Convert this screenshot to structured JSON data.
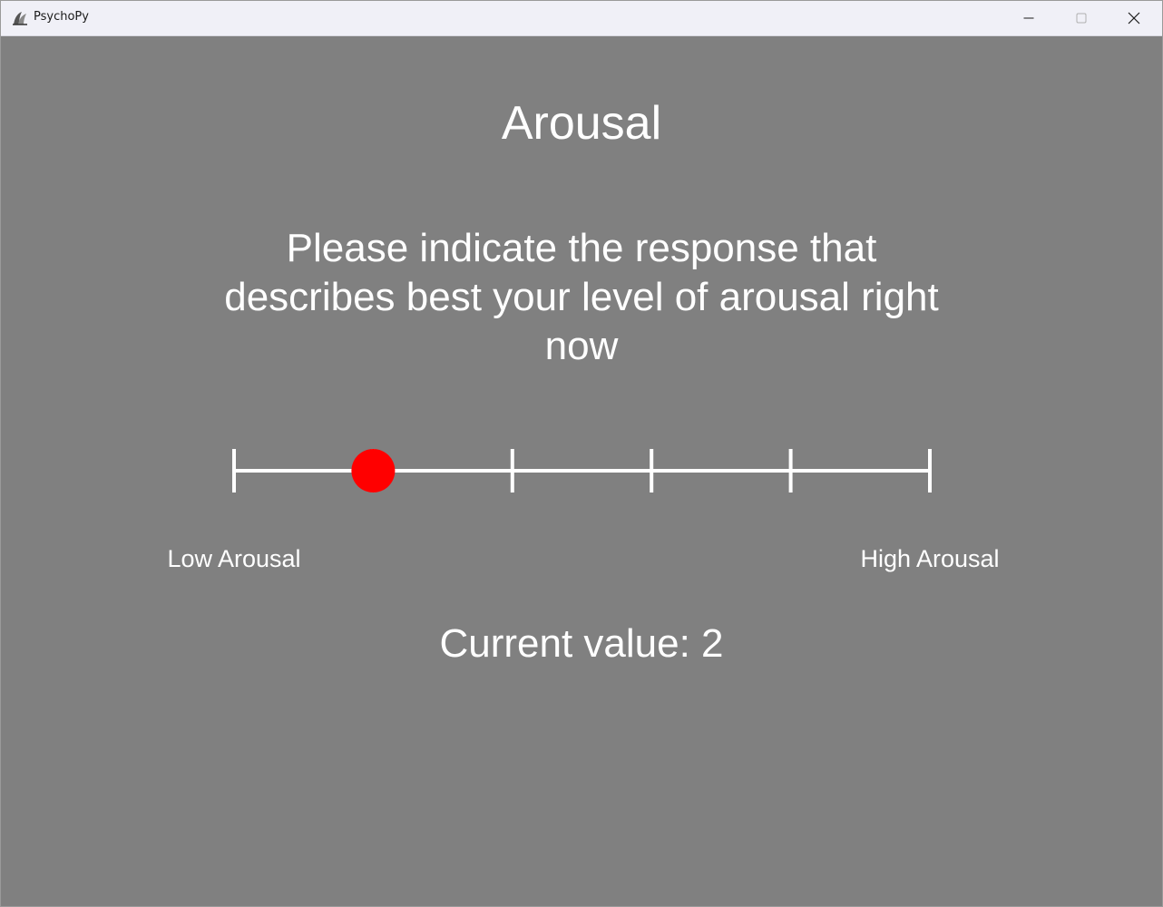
{
  "window": {
    "title": "PsychoPy",
    "icon": "psychopy-icon",
    "controls": [
      "minimize-icon",
      "maximize-icon",
      "close-icon"
    ]
  },
  "background_color": "#808080",
  "marker_color": "#ff0000",
  "rating": {
    "title": "Arousal",
    "instruction": "Please indicate the response that describes best your level of arousal right now",
    "scale_min": 1,
    "scale_max": 6,
    "selected_value": 2,
    "low_label": "Low Arousal",
    "high_label": "High Arousal",
    "current_value_text": "Current value: 2"
  }
}
